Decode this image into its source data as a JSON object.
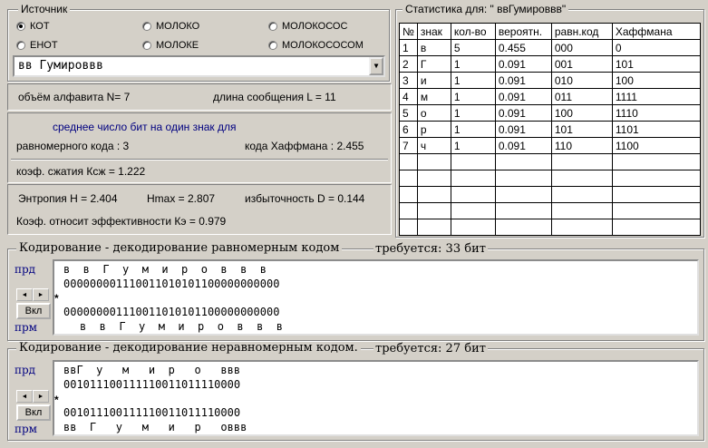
{
  "source": {
    "legend": "Источник",
    "options": [
      "КОТ",
      "МОЛОКО",
      "МОЛОКОСОС",
      "ЕНОТ",
      "МОЛОКЕ",
      "МОЛОКОСОСОМ"
    ],
    "selected_index": 0,
    "combo_value": "вв Гумироввв"
  },
  "info": {
    "alphabet": "объём алфавита N=  7",
    "length": "длина сообщения L =  11",
    "avg_title": "среднее число бит на один знак для",
    "uniform": "равномерного кода :  3",
    "huffman": "кода Хаффмана : 2.455",
    "compression": "коэф. сжатия  Ксж = 1.222",
    "entropy": "Энтропия H = 2.404",
    "hmax": "Hmax = 2.807",
    "redundancy": "избыточность D = 0.144",
    "efficiency": "Коэф. относит эффективности  Кэ = 0.979"
  },
  "stats": {
    "title": "Статистика для: \" ввГумироввв\"",
    "headers": [
      "№",
      "знак",
      "кол-во",
      "вероятн.",
      "равн.код",
      "Хаффмана"
    ],
    "rows": [
      [
        "1",
        "в",
        "5",
        "0.455",
        "000",
        "0"
      ],
      [
        "2",
        "Г",
        "1",
        "0.091",
        "001",
        "101"
      ],
      [
        "3",
        "и",
        "1",
        "0.091",
        "010",
        "100"
      ],
      [
        "4",
        "м",
        "1",
        "0.091",
        "011",
        "1111"
      ],
      [
        "5",
        "о",
        "1",
        "0.091",
        "100",
        "1110"
      ],
      [
        "6",
        "р",
        "1",
        "0.091",
        "101",
        "1101"
      ],
      [
        "7",
        "ч",
        "1",
        "0.091",
        "110",
        "1100"
      ]
    ],
    "empty_rows": 5
  },
  "uniform_coding": {
    "legend": "Кодирование - декодирование равномерным кодом",
    "required": "требуется: 33 бит",
    "prd_label": "прд",
    "prm_label": "прм",
    "send_chars": "в  в  Г  у  м  и  р  о  в  в  в",
    "send_bits": "000000001110011010101100000000000",
    "star": "*",
    "recv_bits": "000000001110011010101100000000000",
    "recv_chars": "в  в  Г  у  м  и  р  о  в  в  в",
    "btn_label": "Вкл"
  },
  "huffman_coding": {
    "legend": "Кодирование - декодирование неравномерным кодом.",
    "required": "требуется: 27 бит",
    "prd_label": "прд",
    "prm_label": "прм",
    "send_chars": "ввГ  у   м   и  р   о   ввв",
    "send_bits": "001011100111110011011110000",
    "star": "*",
    "recv_bits": "001011100111110011011110000",
    "recv_chars": "вв  Г   у   м   и   р   оввв",
    "btn_label": "Вкл"
  },
  "colors": {
    "face": "#d4d0c8",
    "label_blue": "#000080"
  }
}
